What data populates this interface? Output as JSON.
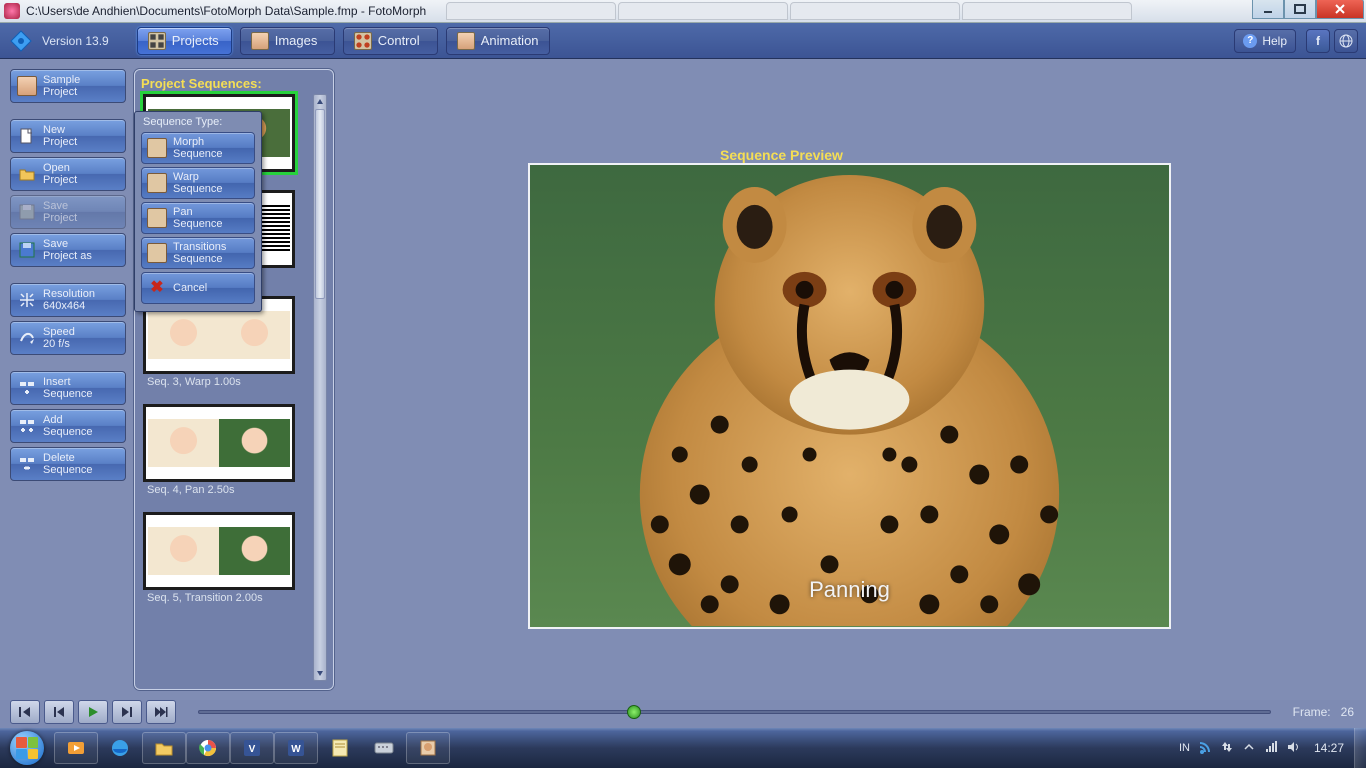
{
  "window": {
    "title": "C:\\Users\\de Andhien\\Documents\\FotoMorph Data\\Sample.fmp - FotoMorph"
  },
  "version": "Version 13.9",
  "tabs": {
    "projects": "Projects",
    "images": "Images",
    "control": "Control",
    "animation": "Animation"
  },
  "help": "Help",
  "sidebar": {
    "sample": "Sample\nProject",
    "new": "New\nProject",
    "open": "Open\nProject",
    "save": "Save\nProject",
    "saveas": "Save\nProject as",
    "resolution": "Resolution\n640x464",
    "speed": "Speed\n20 f/s",
    "insert": "Insert\nSequence",
    "add": "Add\nSequence",
    "delete": "Delete\nSequence"
  },
  "seq_panel_title": "Project Sequences:",
  "sequences": [
    {
      "label": ""
    },
    {
      "label": ""
    },
    {
      "label": "Seq. 3,  Warp 1.00s"
    },
    {
      "label": "Seq. 4,  Pan 2.50s"
    },
    {
      "label": "Seq. 5,  Transition 2.00s"
    }
  ],
  "popup": {
    "title": "Sequence Type:",
    "morph": "Morph\nSequence",
    "warp": "Warp\nSequence",
    "pan": "Pan\nSequence",
    "trans": "Transitions\nSequence",
    "cancel": "Cancel"
  },
  "preview": {
    "title": "Sequence Preview",
    "mode": "Panning"
  },
  "playbar": {
    "frame_label": "Frame:",
    "frame": "26"
  },
  "taskbar": {
    "lang": "IN",
    "time": "14:27"
  }
}
